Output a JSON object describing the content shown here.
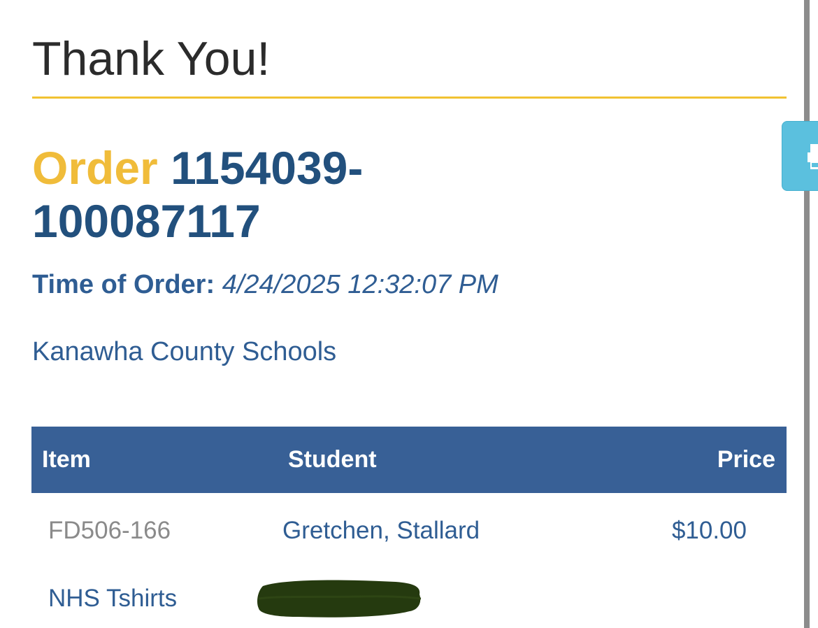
{
  "page": {
    "title": "Thank You!"
  },
  "order": {
    "label": "Order",
    "number": "1154039-100087117",
    "time_label": "Time of Order:",
    "time_value": "4/24/2025 12:32:07 PM",
    "organization": "Kanawha County Schools"
  },
  "table": {
    "headers": {
      "item": "Item",
      "student": "Student",
      "price": "Price"
    },
    "rows": [
      {
        "item_code": "FD506-166",
        "student": "Gretchen, Stallard",
        "price": "$10.00",
        "item_name": "NHS Tshirts"
      }
    ]
  },
  "icons": {
    "print": "print-icon",
    "redaction": "redaction-mark"
  },
  "colors": {
    "heading_text": "#2b2b2b",
    "accent_gold": "#f0bc3a",
    "rule_gold": "#f1c232",
    "order_blue": "#22507d",
    "link_blue": "#2f5d93",
    "table_header_bg": "#386096",
    "print_button_bg": "#5bc0de",
    "redaction": "#253a0f"
  }
}
